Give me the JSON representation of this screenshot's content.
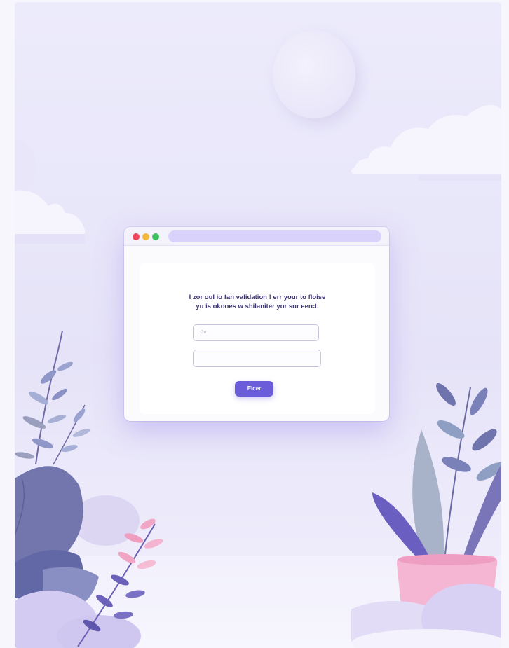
{
  "browser": {
    "message_line1": "I zor oul io fan validation ! err your to floise",
    "message_line2": "yu is okooes w shilaniter yor sur eerct.",
    "field1_value": "Gu",
    "field2_value": "",
    "button_label": "Eicer"
  },
  "colors": {
    "accent": "#6b5cd9",
    "background": "#ecebfb",
    "traffic_red": "#f0465f",
    "traffic_yellow": "#f5b83d",
    "traffic_green": "#3cc05f"
  }
}
